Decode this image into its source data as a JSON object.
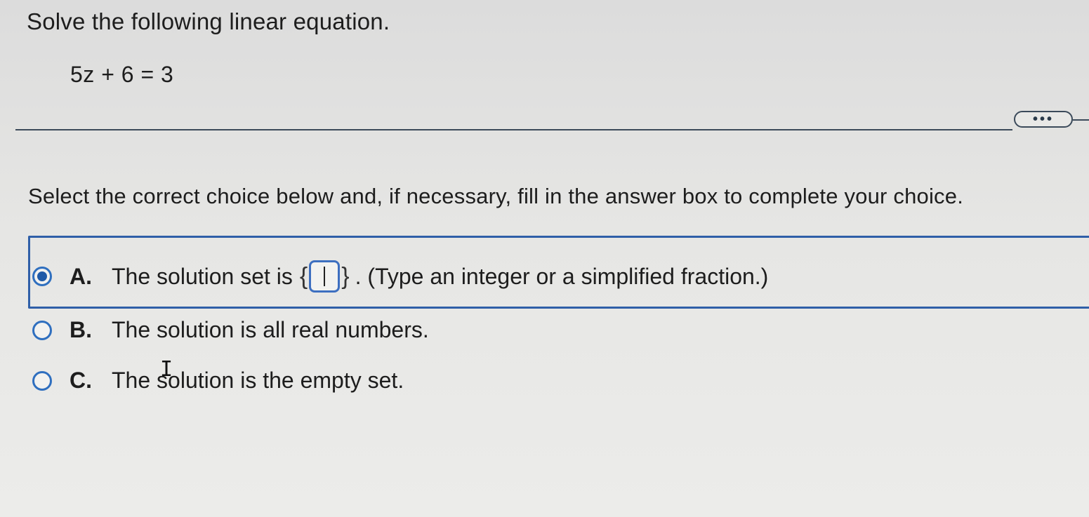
{
  "question": {
    "instruction": "Solve the following linear equation.",
    "equation": "5z + 6 = 3"
  },
  "more_button": {
    "label": "•••"
  },
  "prompt": "Select the correct choice below and, if necessary, fill in the answer box to complete your choice.",
  "choices": [
    {
      "letter": "A.",
      "text_before": "The solution set is",
      "open_brace": "{",
      "close_brace": "}",
      "text_after": ". (Type an integer or a simplified fraction.)",
      "answer_value": "",
      "selected": true
    },
    {
      "letter": "B.",
      "text": "The solution is all real numbers.",
      "selected": false
    },
    {
      "letter": "C.",
      "text": "The solution is the empty set.",
      "selected": false
    }
  ],
  "cursor": {
    "glyph": "I"
  }
}
